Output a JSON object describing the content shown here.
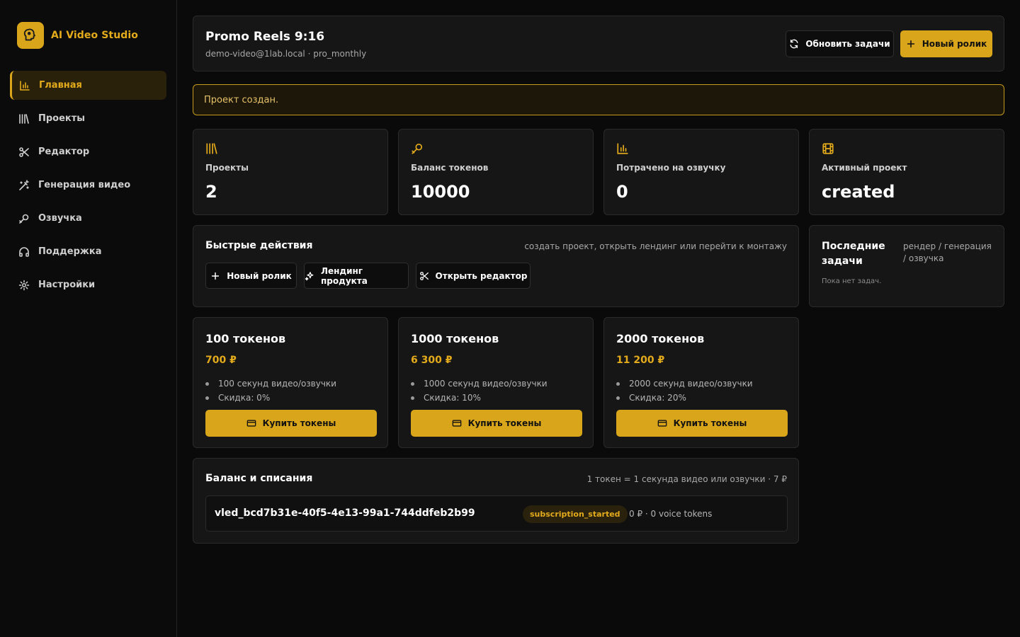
{
  "app": {
    "name": "AI Video Studio"
  },
  "sidebar": {
    "items": [
      {
        "label": "Главная",
        "icon": "chart-bar-icon",
        "active": true
      },
      {
        "label": "Проекты",
        "icon": "library-icon"
      },
      {
        "label": "Редактор",
        "icon": "scissors-icon"
      },
      {
        "label": "Генерация видео",
        "icon": "magic-wand-icon"
      },
      {
        "label": "Озвучка",
        "icon": "microphone-icon"
      },
      {
        "label": "Поддержка",
        "icon": "headphones-icon"
      },
      {
        "label": "Настройки",
        "icon": "gear-icon"
      }
    ]
  },
  "header": {
    "title": "Promo Reels 9:16",
    "subtitle": "demo-video@1lab.local · pro_monthly",
    "refresh_label": "Обновить задачи",
    "new_label": "Новый ролик"
  },
  "notice": {
    "text": "Проект создан."
  },
  "stats": [
    {
      "label": "Проекты",
      "value": "2",
      "icon": "library-icon"
    },
    {
      "label": "Баланс токенов",
      "value": "10000",
      "icon": "microphone-icon"
    },
    {
      "label": "Потрачено на озвучку",
      "value": "0",
      "icon": "chart-bar-icon"
    },
    {
      "label": "Активный проект",
      "value": "created",
      "icon": "film-icon"
    }
  ],
  "quick": {
    "title": "Быстрые действия",
    "hint": "создать проект, открыть лендинг или перейти к монтажу",
    "actions": [
      {
        "label": "Новый ролик",
        "icon": "plus-icon"
      },
      {
        "label": "Лендинг продукта",
        "icon": "sparkles-icon"
      },
      {
        "label": "Открыть редактор",
        "icon": "scissors-icon"
      }
    ]
  },
  "recent": {
    "title": "Последние задачи",
    "hint": "рендер / генерация / озвучка",
    "empty": "Пока нет задач."
  },
  "plans": [
    {
      "title": "100 токенов",
      "price": "700 ₽",
      "features": [
        "100 секунд видео/озвучки",
        "Скидка: 0%"
      ],
      "buy_label": "Купить токены"
    },
    {
      "title": "1000 токенов",
      "price": "6 300 ₽",
      "features": [
        "1000 секунд видео/озвучки",
        "Скидка: 10%"
      ],
      "buy_label": "Купить токены"
    },
    {
      "title": "2000 токенов",
      "price": "11 200 ₽",
      "features": [
        "2000 секунд видео/озвучки",
        "Скидка: 20%"
      ],
      "buy_label": "Купить токены"
    }
  ],
  "balance": {
    "title": "Баланс и списания",
    "hint": "1 токен = 1 секунда видео или озвучки · 7 ₽",
    "row": {
      "id": "vled_bcd7b31e-40f5-4e13-99a1-744ddfeb2b99",
      "status": "subscription_started",
      "amount": "0 ₽ · 0 voice tokens"
    }
  },
  "colors": {
    "accent": "#d9a51a",
    "background": "#0a0a0a",
    "card": "#161616"
  }
}
